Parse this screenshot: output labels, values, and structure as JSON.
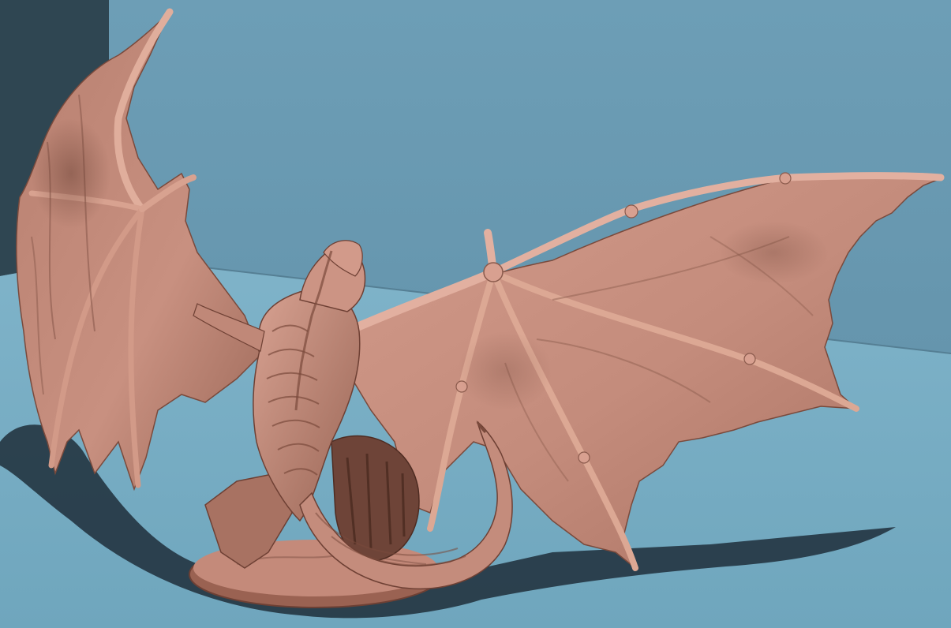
{
  "scene": {
    "subject": "dragon-miniature-render",
    "colors": {
      "back_wall": "#6b9bb3",
      "left_wall": "#2f4652",
      "floor": "#79aec4",
      "shadow": "#1f2e3a",
      "model": "#c08878",
      "model_light": "#d6a090",
      "model_dark": "#8a5a4c"
    }
  }
}
